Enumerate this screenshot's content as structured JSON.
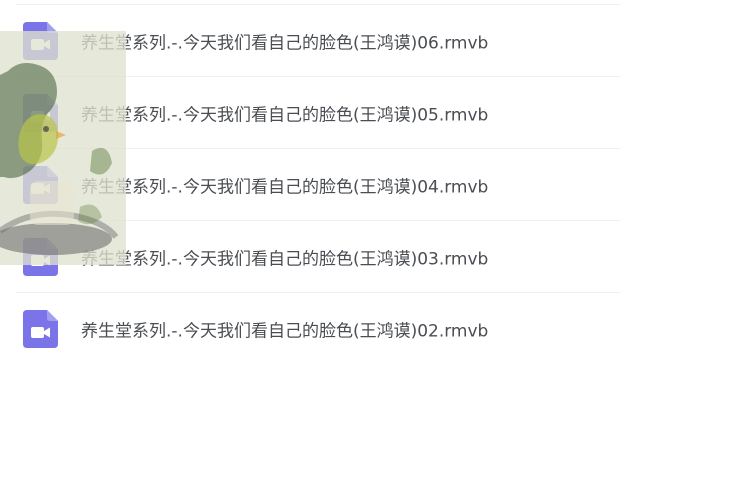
{
  "file_list": {
    "items": [
      {
        "name": "养生堂系列.-.今天我们看自己的脸色(王鸿谟)06.rmvb",
        "icon": "video-file-icon"
      },
      {
        "name": "养生堂系列.-.今天我们看自己的脸色(王鸿谟)05.rmvb",
        "icon": "video-file-icon"
      },
      {
        "name": "养生堂系列.-.今天我们看自己的脸色(王鸿谟)04.rmvb",
        "icon": "video-file-icon"
      },
      {
        "name": "养生堂系列.-.今天我们看自己的脸色(王鸿谟)03.rmvb",
        "icon": "video-file-icon"
      },
      {
        "name": "养生堂系列.-.今天我们看自己的脸色(王鸿谟)02.rmvb",
        "icon": "video-file-icon"
      }
    ]
  },
  "colors": {
    "icon_purple": "#7b74e8",
    "text": "#4a4d52",
    "divider": "#f0f0f2"
  }
}
